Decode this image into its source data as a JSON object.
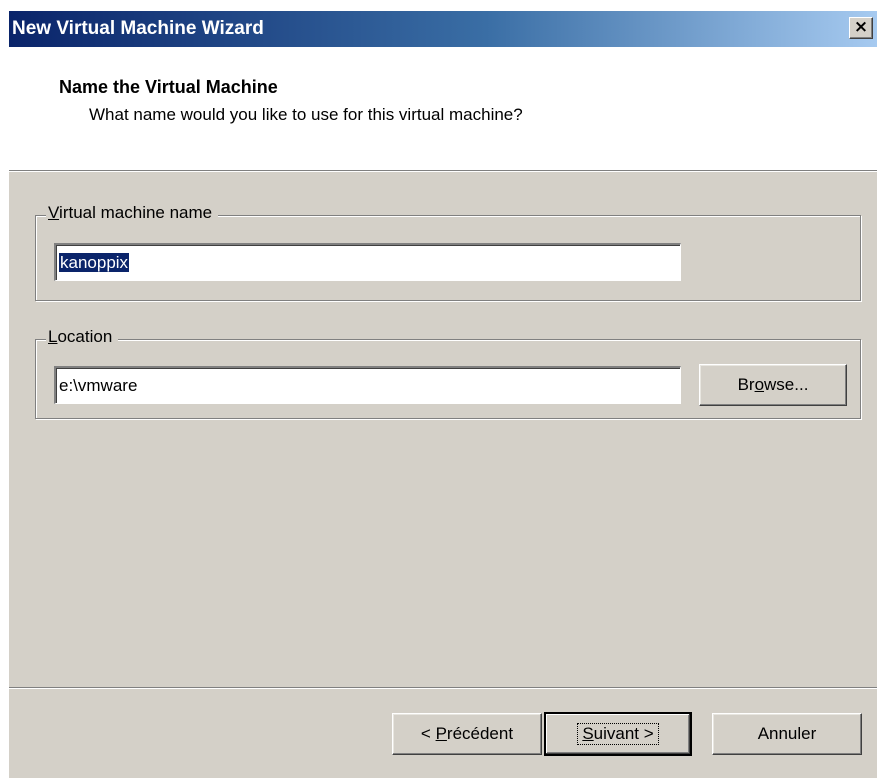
{
  "window": {
    "title": "New Virtual Machine Wizard",
    "close_glyph": "×"
  },
  "header": {
    "title": "Name the Virtual Machine",
    "subtitle": "What name would you like to use for this virtual machine?"
  },
  "name_group": {
    "label_accel": "V",
    "label_rest": "irtual machine name",
    "value": "kanoppix"
  },
  "location_group": {
    "label_accel": "L",
    "label_rest": "ocation",
    "value": "e:\\vmware",
    "browse_pre": "Br",
    "browse_accel": "o",
    "browse_post": "wse..."
  },
  "footer": {
    "prev_pre": "< ",
    "prev_accel": "P",
    "prev_post": "récédent",
    "next_accel": "S",
    "next_post": "uivant >",
    "cancel_label": "Annuler"
  },
  "colors": {
    "title_gradient_start": "#0a246a",
    "title_gradient_end": "#a6caf0",
    "dialog_face": "#d4d0c8",
    "selection": "#0a246a"
  },
  "icons": {
    "close": "close-icon"
  }
}
